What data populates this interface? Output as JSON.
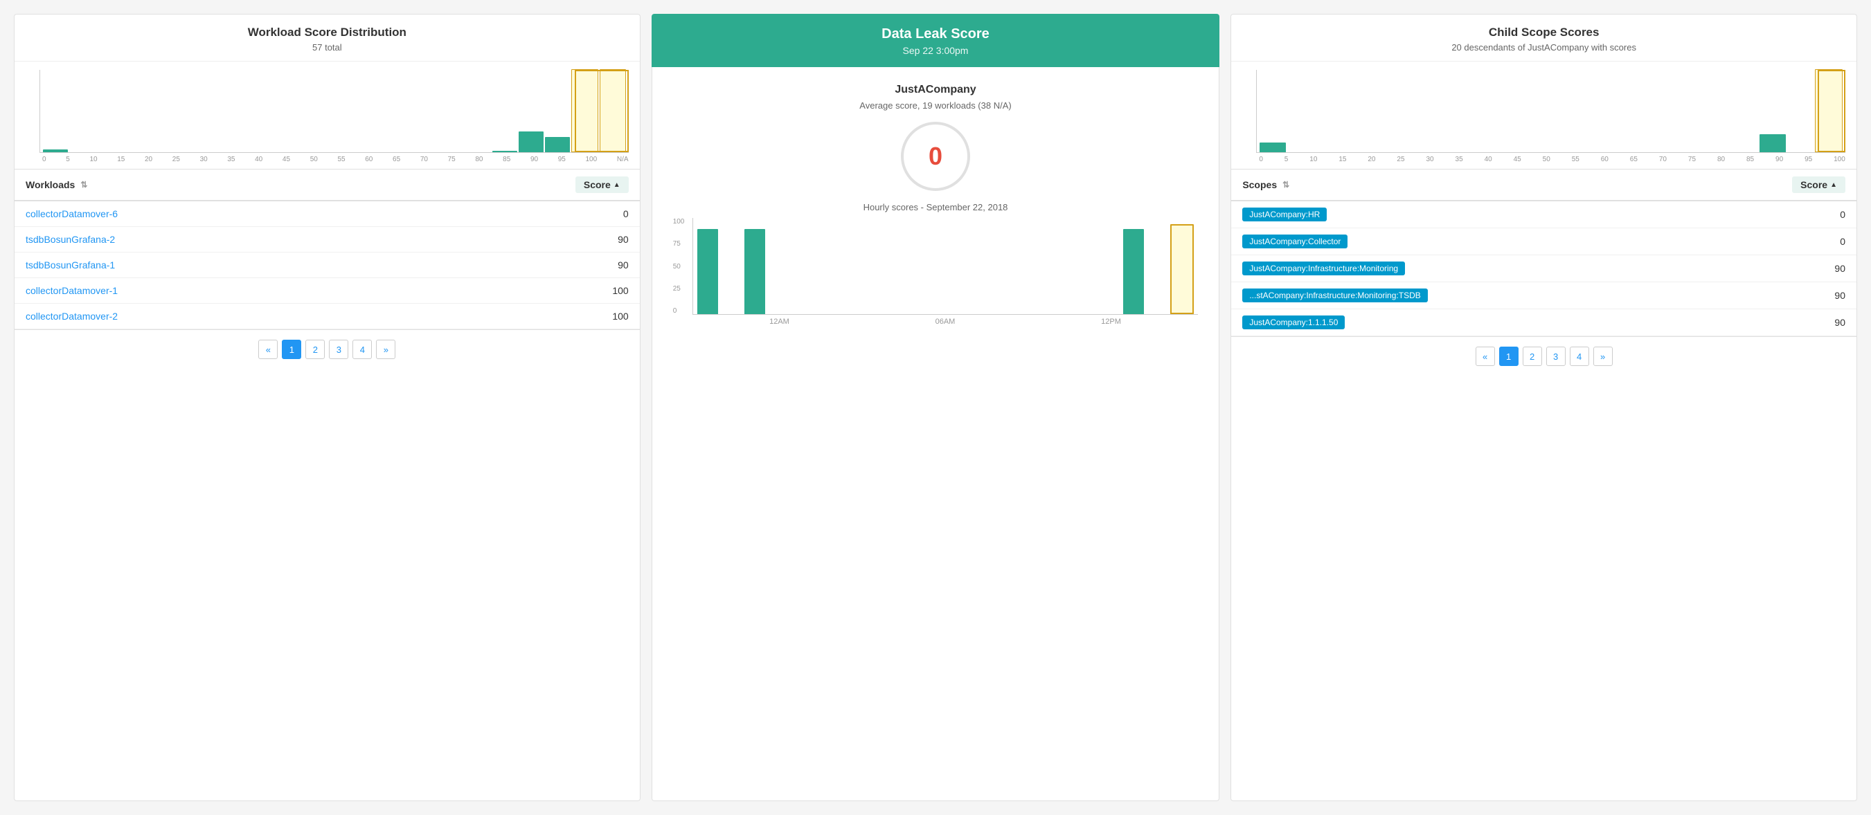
{
  "left_panel": {
    "title": "Workload Score Distribution",
    "subtitle": "57 total",
    "dist_x_labels": [
      "0",
      "5",
      "10",
      "15",
      "20",
      "25",
      "30",
      "35",
      "40",
      "45",
      "50",
      "55",
      "60",
      "65",
      "70",
      "75",
      "80",
      "85",
      "90",
      "95",
      "100",
      "N/A"
    ],
    "dist_bars": [
      {
        "label": "0",
        "height": 3,
        "selected": false
      },
      {
        "label": "5",
        "height": 0,
        "selected": false
      },
      {
        "label": "10",
        "height": 0,
        "selected": false
      },
      {
        "label": "15",
        "height": 0,
        "selected": false
      },
      {
        "label": "20",
        "height": 0,
        "selected": false
      },
      {
        "label": "25",
        "height": 0,
        "selected": false
      },
      {
        "label": "30",
        "height": 0,
        "selected": false
      },
      {
        "label": "35",
        "height": 0,
        "selected": false
      },
      {
        "label": "40",
        "height": 0,
        "selected": false
      },
      {
        "label": "45",
        "height": 0,
        "selected": false
      },
      {
        "label": "50",
        "height": 0,
        "selected": false
      },
      {
        "label": "55",
        "height": 0,
        "selected": false
      },
      {
        "label": "60",
        "height": 0,
        "selected": false
      },
      {
        "label": "65",
        "height": 0,
        "selected": false
      },
      {
        "label": "70",
        "height": 0,
        "selected": false
      },
      {
        "label": "75",
        "height": 0,
        "selected": false
      },
      {
        "label": "80",
        "height": 0,
        "selected": false
      },
      {
        "label": "85",
        "height": 2,
        "selected": false
      },
      {
        "label": "90",
        "height": 25,
        "selected": false
      },
      {
        "label": "95",
        "height": 18,
        "selected": false
      },
      {
        "label": "100",
        "height": 100,
        "selected": true
      },
      {
        "label": "N/A",
        "height": 85,
        "selected": true
      }
    ],
    "table_header": {
      "workloads_col": "Workloads",
      "score_col": "Score"
    },
    "rows": [
      {
        "name": "collectorDatamover-6",
        "score": "0"
      },
      {
        "name": "tsdbBosunGrafana-2",
        "score": "90"
      },
      {
        "name": "tsdbBosunGrafana-1",
        "score": "90"
      },
      {
        "name": "collectorDatamover-1",
        "score": "100"
      },
      {
        "name": "collectorDatamover-2",
        "score": "100"
      }
    ],
    "pagination": {
      "prev": "«",
      "pages": [
        "1",
        "2",
        "3",
        "4"
      ],
      "next": "»",
      "active_page": "1"
    }
  },
  "middle_panel": {
    "header_title": "Data Leak Score",
    "header_subtitle": "Sep 22 3:00pm",
    "company_name": "JustACompany",
    "description": "Average score, 19 workloads (38 N/A)",
    "score": "0",
    "hourly_title": "Hourly scores - September 22, 2018",
    "hourly_y_labels": [
      "100",
      "75",
      "50",
      "25",
      "0"
    ],
    "hourly_bars": [
      {
        "label": "",
        "height": 95,
        "highlighted": false
      },
      {
        "label": "",
        "height": 0,
        "highlighted": false
      },
      {
        "label": "",
        "height": 95,
        "highlighted": false
      },
      {
        "label": "",
        "height": 0,
        "highlighted": false
      },
      {
        "label": "",
        "height": 0,
        "highlighted": false
      },
      {
        "label": "",
        "height": 0,
        "highlighted": false
      },
      {
        "label": "",
        "height": 0,
        "highlighted": false
      },
      {
        "label": "",
        "height": 0,
        "highlighted": false
      },
      {
        "label": "",
        "height": 0,
        "highlighted": false
      },
      {
        "label": "",
        "height": 0,
        "highlighted": false
      },
      {
        "label": "",
        "height": 0,
        "highlighted": false
      },
      {
        "label": "",
        "height": 0,
        "highlighted": false
      },
      {
        "label": "",
        "height": 0,
        "highlighted": false
      },
      {
        "label": "",
        "height": 0,
        "highlighted": false
      },
      {
        "label": "",
        "height": 0,
        "highlighted": false
      },
      {
        "label": "",
        "height": 0,
        "highlighted": false
      },
      {
        "label": "",
        "height": 0,
        "highlighted": false
      },
      {
        "label": "",
        "height": 0,
        "highlighted": false
      },
      {
        "label": "",
        "height": 95,
        "highlighted": false
      },
      {
        "label": "",
        "height": 0,
        "highlighted": false
      },
      {
        "label": "",
        "height": 85,
        "highlighted": true
      }
    ],
    "hourly_x_labels": [
      "12AM",
      "",
      "06AM",
      "",
      "12PM",
      ""
    ]
  },
  "right_panel": {
    "title": "Child Scope Scores",
    "subtitle": "20 descendants of JustACompany with scores",
    "dist_x_labels": [
      "0",
      "5",
      "10",
      "15",
      "20",
      "25",
      "30",
      "35",
      "40",
      "45",
      "50",
      "55",
      "60",
      "65",
      "70",
      "75",
      "80",
      "85",
      "90",
      "95",
      "100"
    ],
    "dist_bars": [
      {
        "label": "0",
        "height": 12,
        "selected": false
      },
      {
        "label": "5",
        "height": 0,
        "selected": false
      },
      {
        "label": "10",
        "height": 0,
        "selected": false
      },
      {
        "label": "15",
        "height": 0,
        "selected": false
      },
      {
        "label": "20",
        "height": 0,
        "selected": false
      },
      {
        "label": "25",
        "height": 0,
        "selected": false
      },
      {
        "label": "30",
        "height": 0,
        "selected": false
      },
      {
        "label": "35",
        "height": 0,
        "selected": false
      },
      {
        "label": "40",
        "height": 0,
        "selected": false
      },
      {
        "label": "45",
        "height": 0,
        "selected": false
      },
      {
        "label": "50",
        "height": 0,
        "selected": false
      },
      {
        "label": "55",
        "height": 0,
        "selected": false
      },
      {
        "label": "60",
        "height": 0,
        "selected": false
      },
      {
        "label": "65",
        "height": 0,
        "selected": false
      },
      {
        "label": "70",
        "height": 0,
        "selected": false
      },
      {
        "label": "75",
        "height": 0,
        "selected": false
      },
      {
        "label": "80",
        "height": 0,
        "selected": false
      },
      {
        "label": "85",
        "height": 0,
        "selected": false
      },
      {
        "label": "90",
        "height": 22,
        "selected": false
      },
      {
        "label": "95",
        "height": 0,
        "selected": false
      },
      {
        "label": "100",
        "height": 100,
        "selected": true
      }
    ],
    "table_header": {
      "scopes_col": "Scopes",
      "score_col": "Score"
    },
    "rows": [
      {
        "name": "JustACompany:HR",
        "score": "0"
      },
      {
        "name": "JustACompany:Collector",
        "score": "0"
      },
      {
        "name": "JustACompany:Infrastructure:Monitoring",
        "score": "90"
      },
      {
        "name": "...stACompany:Infrastructure:Monitoring:TSDB",
        "score": "90"
      },
      {
        "name": "JustACompany:1.1.1.50",
        "score": "90"
      }
    ],
    "pagination": {
      "prev": "«",
      "pages": [
        "1",
        "2",
        "3",
        "4"
      ],
      "next": "»",
      "active_page": "1"
    }
  }
}
